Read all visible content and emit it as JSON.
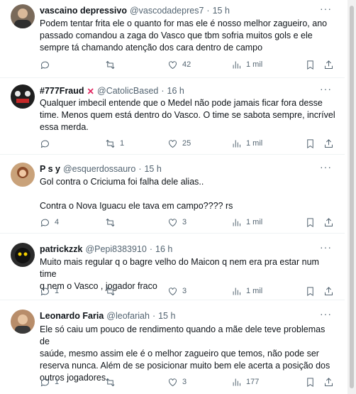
{
  "tweets": [
    {
      "name": "vascaino depressivo",
      "handle": "@vascodadepres7",
      "dot": "·",
      "time": "15 h",
      "lines": [
        "Podem tentar frita ele o quanto for mas ele é nosso melhor zagueiro, ano",
        "passado comandou a zaga do Vasco que tbm sofria muitos gols e ele",
        "sempre tá chamando atenção dos cara dentro de campo"
      ],
      "replies": "",
      "retweets": "",
      "likes": "42",
      "views": "1 mil"
    },
    {
      "name": "#777Fraud",
      "flag": "✕",
      "handle": "@CatolicBased",
      "dot": "·",
      "time": "16 h",
      "lines": [
        "Qualquer imbecil entende que o Medel não pode jamais ficar fora desse",
        "time. Menos quem está dentro do Vasco. O time se sabota sempre, incrível",
        "essa merda."
      ],
      "replies": "",
      "retweets": "1",
      "likes": "25",
      "views": "1 mil"
    },
    {
      "name": "P s y",
      "handle": "@esquerdossauro",
      "dot": "·",
      "time": "15 h",
      "lines": [
        "Gol contra o Criciuma foi falha dele alias..",
        "",
        "Contra o Nova Iguacu ele tava em campo???? rs"
      ],
      "replies": "4",
      "retweets": "",
      "likes": "3",
      "views": "1 mil"
    },
    {
      "name": "patrickzzk",
      "handle": "@Pepi8383910",
      "dot": "·",
      "time": "16 h",
      "lines": [
        "Muito mais regular q o bagre velho do Maicon q nem era pra estar num time",
        "q nem o Vasco , jogador fraco"
      ],
      "replies": "1",
      "retweets": "",
      "likes": "3",
      "views": "1 mil"
    },
    {
      "name": "Leonardo Faria",
      "handle": "@leofariah",
      "dot": "·",
      "time": "15 h",
      "lines": [
        "Ele só caiu um pouco de rendimento quando a mãe dele teve problemas de",
        "saúde, mesmo assim ele é o melhor zagueiro que temos, não pode ser",
        "reserva nunca. Além de se posicionar muito bem ele acerta a posição dos",
        "outros jogadores."
      ],
      "replies": "1",
      "retweets": "",
      "likes": "3",
      "views": "177"
    }
  ],
  "more_label": "···",
  "colors": {
    "text": "#0f1419",
    "muted": "#536471",
    "border": "#eff3f4",
    "flag": "#e0245e"
  },
  "icons": [
    "reply-icon",
    "retweet-icon",
    "like-icon",
    "views-icon",
    "bookmark-icon",
    "share-icon",
    "more-icon"
  ]
}
